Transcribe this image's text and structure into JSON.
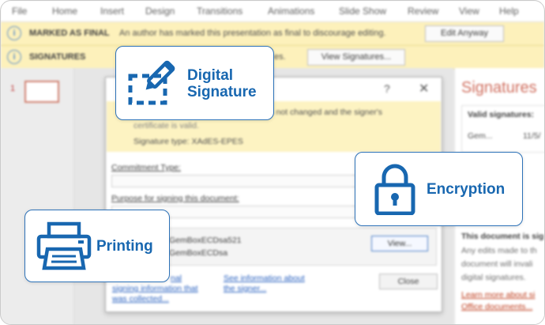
{
  "menu": [
    "File",
    "Home",
    "Insert",
    "Design",
    "Transitions",
    "Animations",
    "Slide Show",
    "Review",
    "View",
    "Help"
  ],
  "final_bar": {
    "label": "MARKED AS FINAL",
    "message": "An author has marked this presentation as final to discourage editing.",
    "button": "Edit Anyway"
  },
  "sig_bar": {
    "label": "SIGNATURES",
    "message_tail": "es.",
    "button": "View Signatures..."
  },
  "thumbnails": {
    "number": "1"
  },
  "dialog": {
    "help": "?",
    "close_x": "✕",
    "valid_line1": "nt has not changed and the signer's",
    "valid_line2": "certificate is valid.",
    "sig_type": "Signature type: XAdES-EPES",
    "commitment_label": "Commitment Type:",
    "purpose_label": "Purpose for signing this document:",
    "signer_name": "GemBoxECDsa521",
    "signer_issuer": "GemBoxECDsa",
    "view_button": "View...",
    "link_left_1": "nal",
    "link_left_2": "signing information that",
    "link_left_3": "was collected...",
    "link_right_1": "See information about",
    "link_right_2": "the signer...",
    "close_button": "Close"
  },
  "pane": {
    "title": "Signatures",
    "valid_header": "Valid signatures:",
    "row_name": "Gem...",
    "row_date": "11/5/",
    "notice_title": "This document is sig",
    "notice_1": "Any edits made to th",
    "notice_2": "document will invali",
    "notice_3": "digital signatures.",
    "link_1": "Learn more about si",
    "link_2": "Office documents..."
  },
  "cards": {
    "digital_signature_1": "Digital",
    "digital_signature_2": "Signature",
    "encryption": "Encryption",
    "printing": "Printing"
  },
  "colors": {
    "accent": "#1867b0",
    "card_border": "#2d72b8",
    "info_bar": "#fdf1bb"
  },
  "icons": [
    "info-icon",
    "digital-signature-icon",
    "lock-icon",
    "printer-icon"
  ]
}
